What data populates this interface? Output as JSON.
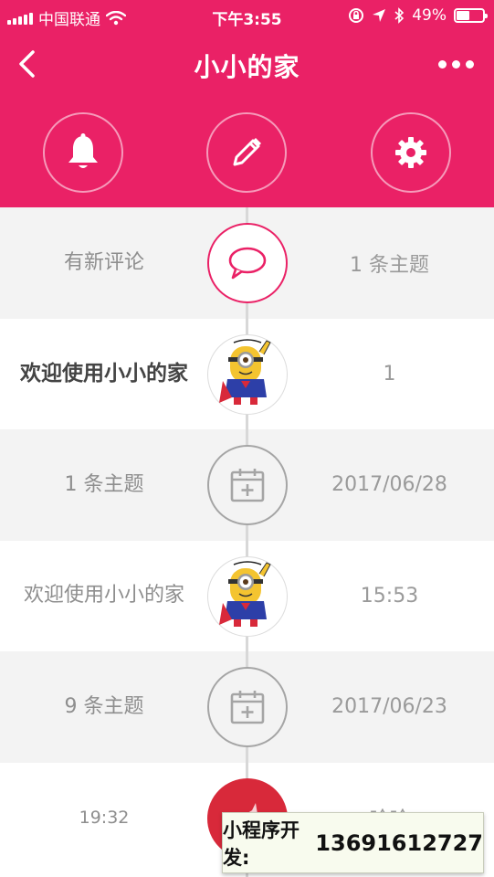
{
  "status": {
    "carrier": "中国联通",
    "time": "下午3:55",
    "battery": "49%",
    "battery_level": 0.49
  },
  "header": {
    "title": "小小的家",
    "back_icon": "chevron-left-icon",
    "more_icon": "more-dots-icon",
    "buttons": [
      {
        "name": "notifications",
        "icon": "bell-icon"
      },
      {
        "name": "edit",
        "icon": "pencil-icon"
      },
      {
        "name": "settings",
        "icon": "gear-icon"
      }
    ]
  },
  "timeline": [
    {
      "left": "有新评论",
      "right": "1 条主题",
      "icon": "comment-icon"
    },
    {
      "left": "欢迎使用小小的家",
      "right": "1",
      "icon": "minion-avatar"
    },
    {
      "left": "1 条主题",
      "right": "2017/06/28",
      "icon": "calendar-add-icon"
    },
    {
      "left": "欢迎使用小小的家",
      "right": "15:53",
      "icon": "minion-avatar"
    },
    {
      "left": "9 条主题",
      "right": "2017/06/23",
      "icon": "calendar-add-icon"
    },
    {
      "left": "19:32",
      "right": "哈哈",
      "icon": "red-avatar"
    }
  ],
  "watermark": {
    "label": "小程序开发:",
    "phone": "13691612727"
  },
  "colors": {
    "accent": "#ea2166"
  }
}
